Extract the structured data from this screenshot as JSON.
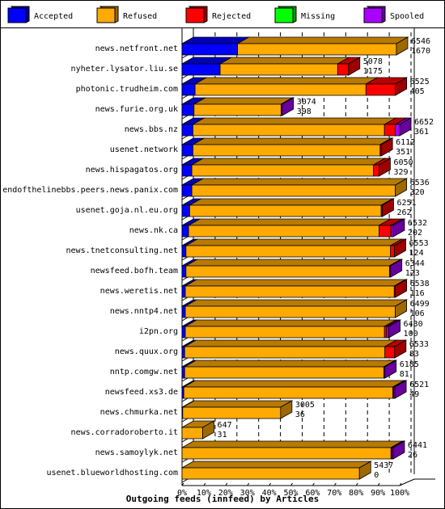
{
  "chart_data": {
    "type": "bar",
    "orientation": "horizontal",
    "stacked": "percent",
    "title": "Outgoing feeds (innfeed) by Articles",
    "xlabel": "",
    "ylabel": "",
    "xlim": [
      0,
      100
    ],
    "x_ticks": [
      "0%",
      "10%",
      "20%",
      "30%",
      "40%",
      "50%",
      "60%",
      "70%",
      "80%",
      "90%",
      "100%"
    ],
    "grid": true,
    "legend_position": "top",
    "legend": [
      {
        "name": "Accepted",
        "color": "#0000ff"
      },
      {
        "name": "Refused",
        "color": "#ffaa00"
      },
      {
        "name": "Rejected",
        "color": "#ff0000"
      },
      {
        "name": "Missing",
        "color": "#00ff00"
      },
      {
        "name": "Spooled",
        "color": "#aa00ff"
      }
    ],
    "categories": [
      "news.netfront.net",
      "nyheter.lysator.liu.se",
      "photonic.trudheim.com",
      "news.furie.org.uk",
      "news.bbs.nz",
      "usenet.network",
      "news.hispagatos.org",
      "endofthelinebbs.peers.news.panix.com",
      "usenet.goja.nl.eu.org",
      "news.nk.ca",
      "news.tnetconsulting.net",
      "newsfeed.bofh.team",
      "news.weretis.net",
      "news.nntp4.net",
      "i2pn.org",
      "news.quux.org",
      "nntp.comgw.net",
      "newsfeed.xs3.de",
      "news.chmurka.net",
      "news.corradoroberto.it",
      "news.samoylyk.net",
      "usenet.blueworldhosting.com"
    ],
    "totals": [
      6546,
      5078,
      6525,
      3074,
      6652,
      6112,
      6050,
      6536,
      6251,
      6532,
      6553,
      6344,
      6538,
      6499,
      6430,
      6533,
      6185,
      6521,
      3005,
      647,
      6441,
      5437
    ],
    "accepted_counts": [
      1670,
      1175,
      405,
      398,
      361,
      351,
      329,
      320,
      262,
      202,
      124,
      123,
      116,
      106,
      100,
      83,
      81,
      49,
      36,
      31,
      26,
      0
    ],
    "series": [
      {
        "name": "Accepted",
        "values": [
          25.5,
          17.5,
          6.0,
          5.5,
          5.0,
          5.0,
          4.5,
          4.5,
          3.5,
          3.0,
          1.8,
          1.8,
          1.5,
          1.5,
          1.5,
          1.2,
          1.2,
          0.8,
          0.3,
          0.0,
          0.0,
          0.0
        ]
      },
      {
        "name": "Refused",
        "values": [
          73.0,
          54.0,
          78.5,
          40.0,
          88.0,
          86.0,
          83.5,
          93.5,
          88.0,
          87.5,
          94.0,
          93.5,
          96.0,
          96.5,
          91.5,
          92.0,
          91.5,
          96.0,
          45.0,
          9.5,
          96.0,
          81.5
        ]
      },
      {
        "name": "Rejected",
        "values": [
          0.0,
          5.0,
          13.5,
          0.0,
          5.0,
          0.5,
          2.5,
          0.0,
          0.5,
          5.5,
          1.8,
          0.0,
          0.5,
          0.0,
          1.0,
          4.5,
          0.0,
          0.5,
          0.0,
          0.0,
          0.5,
          0.0
        ]
      },
      {
        "name": "Missing",
        "values": [
          0,
          0,
          0,
          0,
          0,
          0,
          0,
          0,
          0,
          0,
          0,
          0,
          0,
          0,
          0,
          0,
          0,
          0,
          0,
          0,
          0,
          0
        ]
      },
      {
        "name": "Spooled",
        "values": [
          0.0,
          0.0,
          0.0,
          0.5,
          2.0,
          0.0,
          0.0,
          0.0,
          0.0,
          1.0,
          0.0,
          0.5,
          0.0,
          0.0,
          1.0,
          0.0,
          0.5,
          0.5,
          0.0,
          0.0,
          0.5,
          0.0
        ]
      }
    ]
  }
}
